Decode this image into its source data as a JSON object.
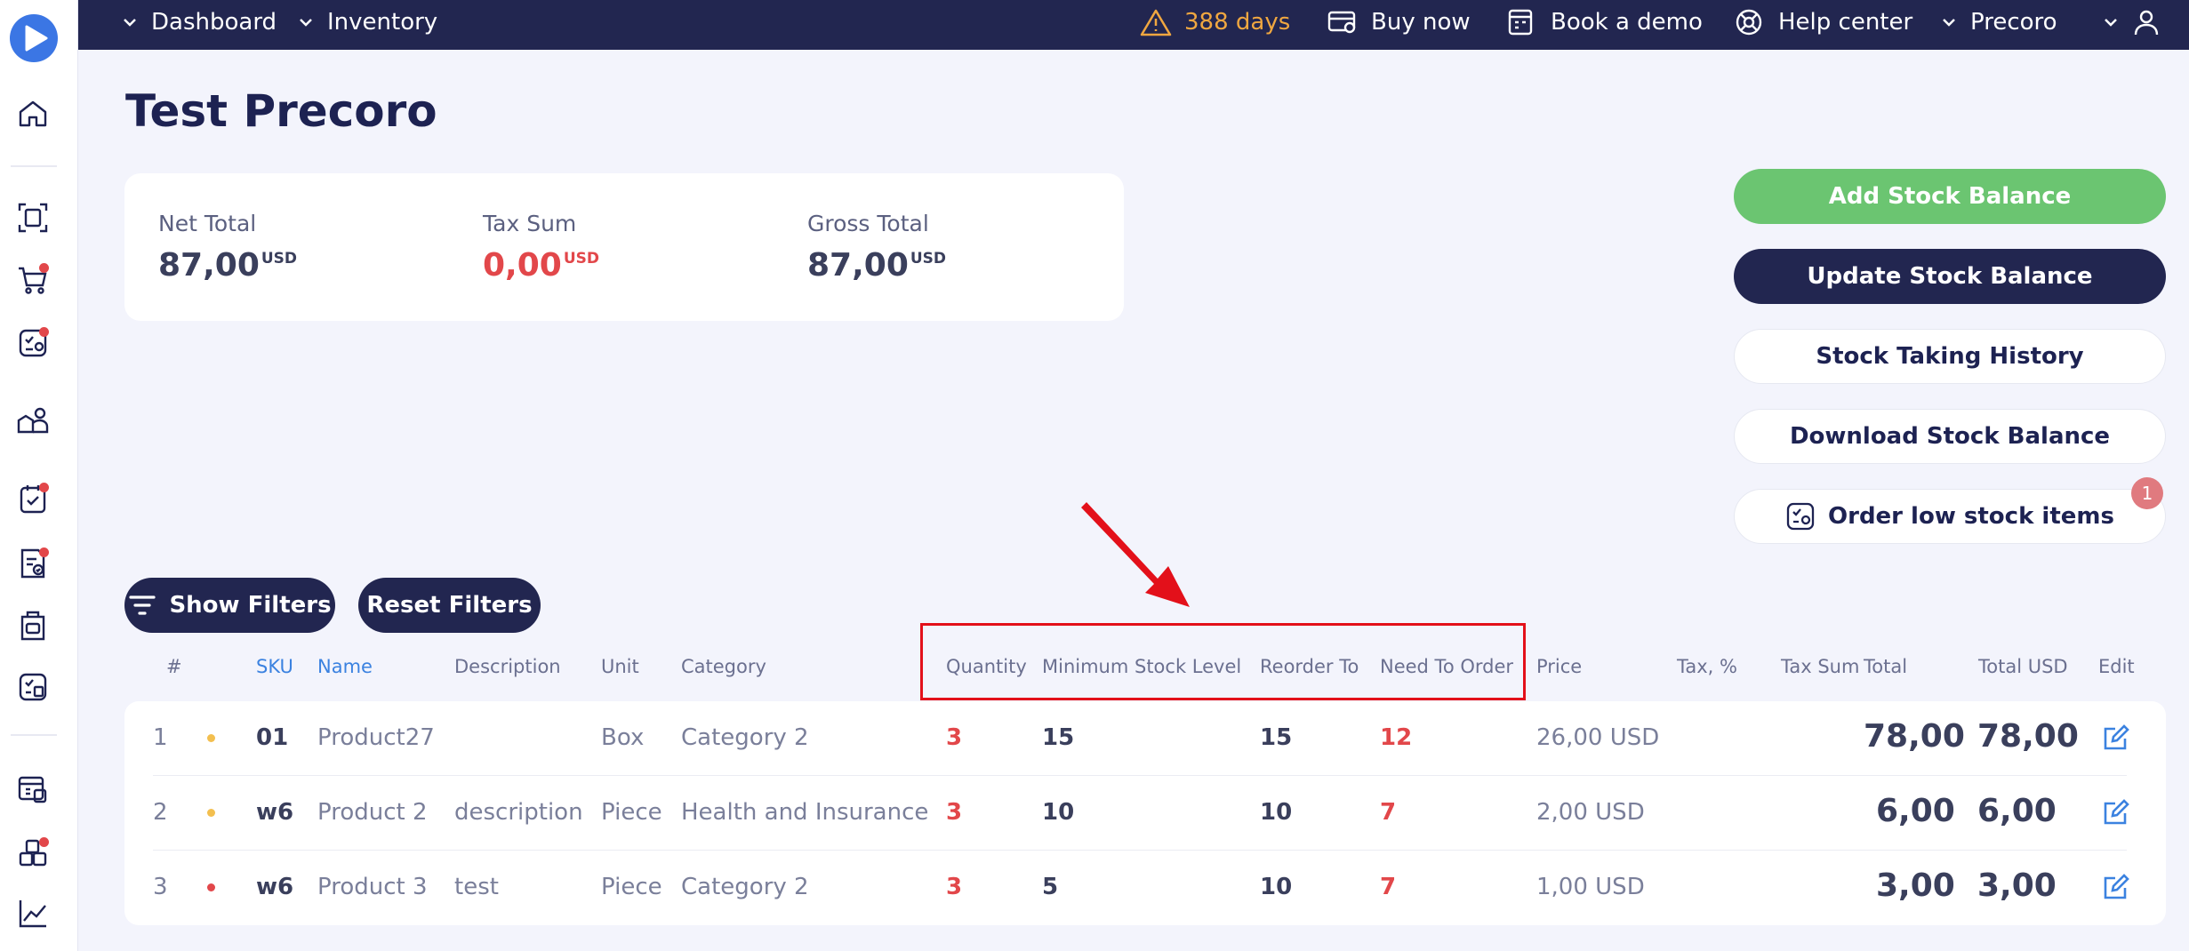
{
  "topbar": {
    "nav": [
      "Dashboard",
      "Inventory"
    ],
    "trial": "388 days",
    "buy_now": "Buy now",
    "book_demo": "Book a demo",
    "help_center": "Help center",
    "company": "Precoro"
  },
  "page": {
    "title": "Test Precoro"
  },
  "totals": {
    "net_label": "Net Total",
    "net_value": "87,00",
    "net_currency": "USD",
    "tax_label": "Tax Sum",
    "tax_value": "0,00",
    "tax_currency": "USD",
    "gross_label": "Gross Total",
    "gross_value": "87,00",
    "gross_currency": "USD"
  },
  "actions": {
    "add": "Add Stock Balance",
    "update": "Update Stock Balance",
    "history": "Stock Taking History",
    "download": "Download Stock Balance",
    "order_low": "Order low stock items",
    "order_low_badge": "1"
  },
  "filters": {
    "show": "Show Filters",
    "reset": "Reset Filters"
  },
  "table": {
    "headers": {
      "num": "#",
      "sku": "SKU",
      "name": "Name",
      "description": "Description",
      "unit": "Unit",
      "category": "Category",
      "quantity": "Quantity",
      "min_stock": "Minimum Stock Level",
      "reorder_to": "Reorder To",
      "need_to_order": "Need To Order",
      "price": "Price",
      "tax_pct": "Tax, %",
      "tax_sum": "Tax Sum",
      "total": "Total",
      "total_usd": "Total USD",
      "edit": "Edit"
    },
    "rows": [
      {
        "num": "1",
        "status_color": "#f3bf4f",
        "sku": "01",
        "name": "Product27",
        "description": "",
        "unit": "Box",
        "category": "Category 2",
        "quantity": "3",
        "min_stock": "15",
        "reorder_to": "15",
        "need_to_order": "12",
        "price": "26,00 USD",
        "total": "78,00",
        "total_usd": "78,00"
      },
      {
        "num": "2",
        "status_color": "#f3bf4f",
        "sku": "w6",
        "name": "Product 2",
        "description": "description",
        "unit": "Piece",
        "category": "Health and Insurance",
        "quantity": "3",
        "min_stock": "10",
        "reorder_to": "10",
        "need_to_order": "7",
        "price": "2,00 USD",
        "total": "6,00",
        "total_usd": "6,00"
      },
      {
        "num": "3",
        "status_color": "#e2474a",
        "sku": "w6",
        "name": "Product 3",
        "description": "test",
        "unit": "Piece",
        "category": "Category 2",
        "quantity": "3",
        "min_stock": "5",
        "reorder_to": "10",
        "need_to_order": "7",
        "price": "1,00 USD",
        "total": "3,00",
        "total_usd": "3,00"
      }
    ]
  },
  "icons": {
    "logo": "play-logo-icon",
    "home": "home-icon",
    "scan": "scan-icon",
    "cart": "cart-icon",
    "approvals": "approvals-icon",
    "suppliers": "suppliers-icon",
    "tasks": "tasks-icon",
    "invoices": "invoices-icon",
    "receipts": "receipts-icon",
    "budgets": "budgets-icon",
    "catalog": "catalog-icon",
    "warehouse": "warehouse-icon",
    "analytics": "analytics-icon"
  },
  "colors": {
    "navy": "#222650",
    "green": "#6bc571",
    "red": "#e2474a",
    "accent": "#3b82e0",
    "warning": "#f0a740"
  }
}
